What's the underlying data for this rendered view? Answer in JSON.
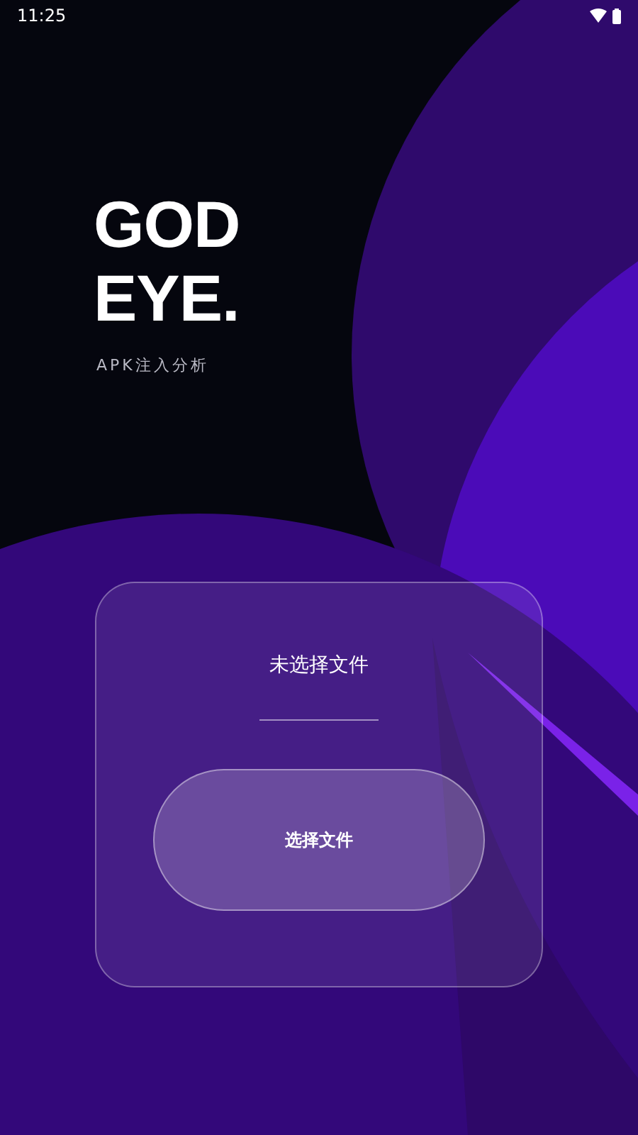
{
  "status_bar": {
    "time": "11:25"
  },
  "title_lines": [
    "GOD",
    "EYE."
  ],
  "subtitle": "APK注入分析",
  "card": {
    "status_text": "未选择文件",
    "button": "选择文件"
  }
}
